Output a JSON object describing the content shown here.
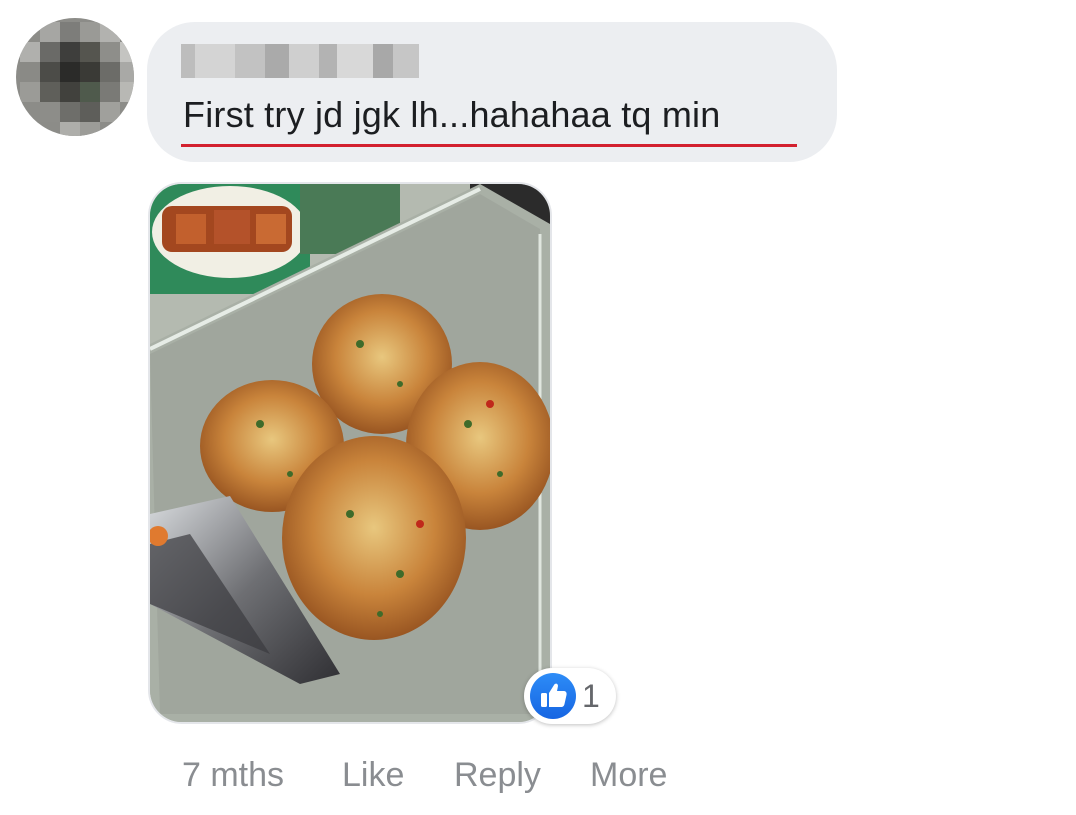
{
  "comment": {
    "author_name_visible": false,
    "text": "First try jd jgk lh...hahahaa tq min",
    "spellcheck_underline_color": "#d3212f"
  },
  "attachment": {
    "kind": "photo"
  },
  "reaction": {
    "icon": "thumbs-up-icon",
    "count": "1",
    "color": "#1877f2"
  },
  "actions": {
    "timestamp": "7 mths",
    "like": "Like",
    "reply": "Reply",
    "more": "More"
  },
  "colors": {
    "bubble_bg": "#eceef1",
    "text": "#1c1e21",
    "muted": "#8a8d91"
  }
}
